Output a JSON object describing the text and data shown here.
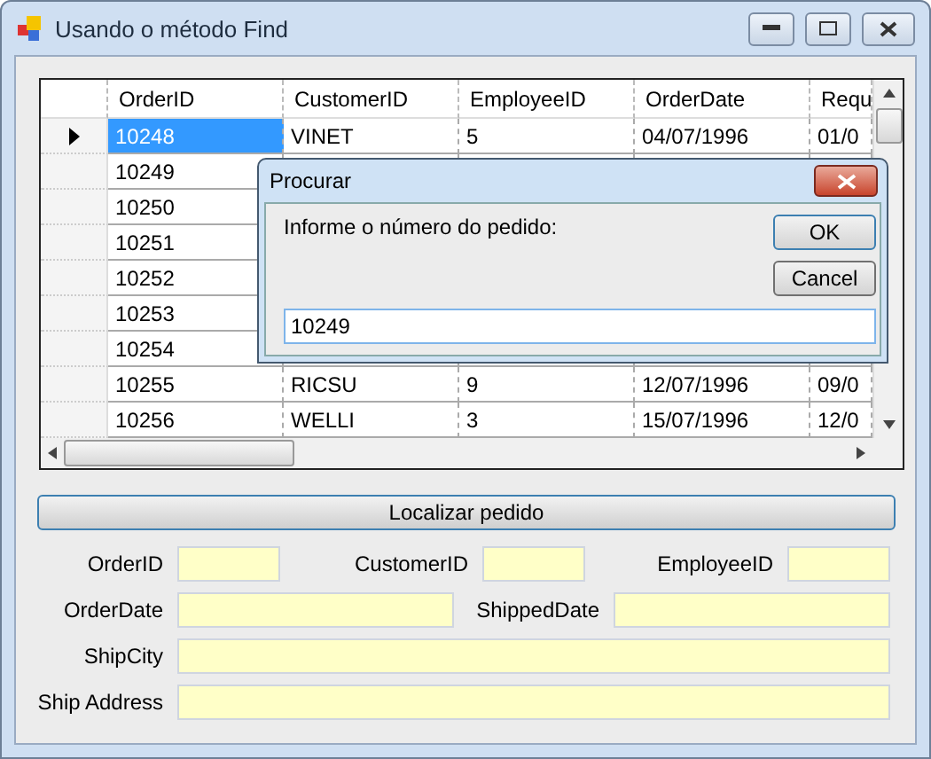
{
  "window": {
    "title": "Usando o método Find"
  },
  "grid": {
    "columns": [
      "OrderID",
      "CustomerID",
      "EmployeeID",
      "OrderDate",
      "Requ"
    ],
    "rows": [
      {
        "selected": true,
        "cells": [
          "10248",
          "VINET",
          "5",
          "04/07/1996",
          "01/0"
        ]
      },
      {
        "selected": false,
        "cells": [
          "10249"
        ]
      },
      {
        "selected": false,
        "cells": [
          "10250"
        ]
      },
      {
        "selected": false,
        "cells": [
          "10251"
        ]
      },
      {
        "selected": false,
        "cells": [
          "10252"
        ]
      },
      {
        "selected": false,
        "cells": [
          "10253"
        ]
      },
      {
        "selected": false,
        "cells": [
          "10254"
        ]
      },
      {
        "selected": false,
        "cells": [
          "10255",
          "RICSU",
          "9",
          "12/07/1996",
          "09/0"
        ]
      },
      {
        "selected": false,
        "cells": [
          "10256",
          "WELLI",
          "3",
          "15/07/1996",
          "12/0"
        ]
      }
    ]
  },
  "dialog": {
    "title": "Procurar",
    "prompt": "Informe o número do pedido:",
    "buttons": [
      "OK",
      "Cancel"
    ],
    "input": {
      "value": "10249"
    }
  },
  "search_button": "Localizar pedido",
  "form": [
    {
      "fields": [
        {
          "label": "OrderID"
        },
        {
          "label": "CustomerID"
        },
        {
          "label": "EmployeeID"
        }
      ]
    },
    {
      "fields": [
        {
          "label": "OrderDate"
        },
        {
          "label": "ShippedDate"
        }
      ]
    },
    {
      "fields": [
        {
          "label": "ShipCity"
        }
      ]
    },
    {
      "fields": [
        {
          "label": "Ship Address"
        }
      ]
    }
  ]
}
